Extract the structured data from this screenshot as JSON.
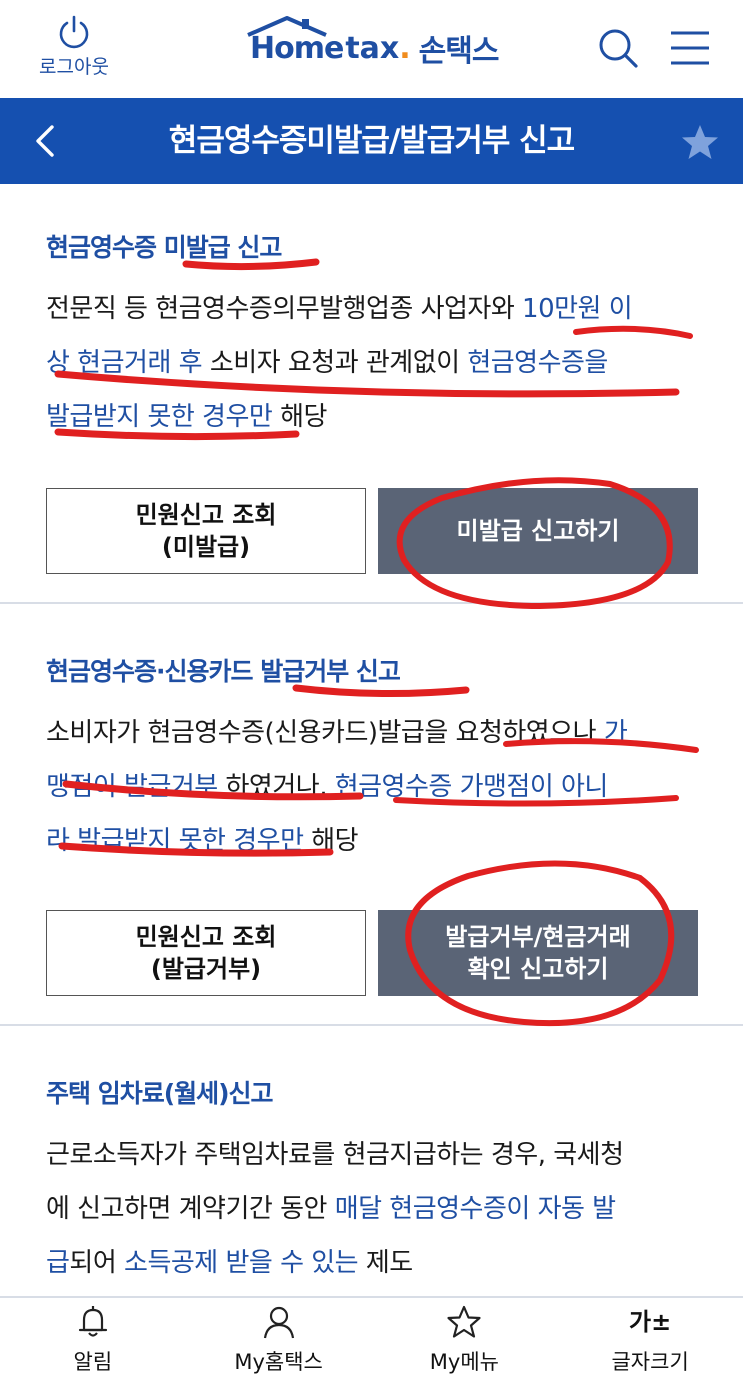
{
  "header": {
    "logout_label": "로그아웃",
    "brand_home": "Home",
    "brand_tax": "tax",
    "brand_son": "손택스",
    "icons": {
      "logout": "power-icon",
      "search": "search-icon",
      "menu": "hamburger-menu-icon"
    }
  },
  "titlebar": {
    "title": "현금영수증미발급/발급거부 신고",
    "icons": {
      "back": "chevron-left-icon",
      "favorite": "star-icon"
    }
  },
  "sections": [
    {
      "heading": "현금영수증 미발급 신고",
      "desc_lines": [
        [
          "전문직 등 현금영수증의무발행업종 사업자와 ",
          "10만원 이"
        ],
        [
          "상 현금거래 후",
          " 소비자 요청과 관계없이 ",
          "현금영수증을"
        ],
        [
          "발급받지 못한 경우만",
          " 해당"
        ]
      ],
      "inquiry_button": {
        "line1": "민원신고 조회",
        "line2": "(미발급)"
      },
      "report_button": {
        "line1": "미발급 신고하기"
      }
    },
    {
      "heading": "현금영수증·신용카드 발급거부 신고",
      "desc_lines": [
        [
          "소비자가 현금영수증(신용카드)발급을 요청하였으나 ",
          "가"
        ],
        [
          "맹점이 발급거부",
          " 하였거나, ",
          "현금영수증 가맹점이 아니"
        ],
        [
          "라 발급받지 못한 경우만",
          " 해당"
        ]
      ],
      "inquiry_button": {
        "line1": "민원신고 조회",
        "line2": "(발급거부)"
      },
      "report_button": {
        "line1": "발급거부/현금거래",
        "line2": "확인 신고하기"
      }
    },
    {
      "heading": "주택 임차료(월세)신고",
      "desc_lines": [
        [
          "근로소득자가 주택임차료를 현금지급하는 경우, 국세청"
        ],
        [
          "에 신고하면 계약기간 동안 ",
          "매달 현금영수증이 자동 발"
        ],
        [
          "급",
          "되어 ",
          "소득공제 받을 수 있는",
          " 제도"
        ]
      ]
    }
  ],
  "bottom_nav": [
    {
      "label": "알림",
      "icon": "bell-icon"
    },
    {
      "label": "My홈택스",
      "icon": "user-icon"
    },
    {
      "label": "My메뉴",
      "icon": "star-outline-icon"
    },
    {
      "label": "글자크기",
      "icon": "font-size-icon",
      "glyph": "가±"
    }
  ],
  "colors": {
    "brand_blue": "#1550b0",
    "link_blue": "#1f4fa3",
    "button_gray": "#5a6476",
    "annotation_red": "#e02020",
    "accent_orange": "#f08c1e"
  }
}
